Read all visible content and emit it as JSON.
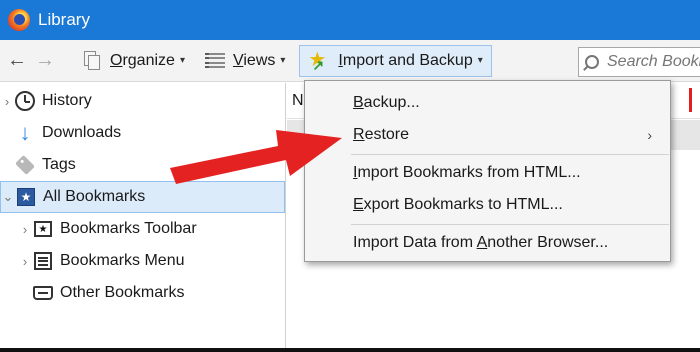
{
  "window": {
    "title": "Library"
  },
  "toolbar": {
    "organize_label": "Organize",
    "organize_hotkey": "O",
    "organize_rest": "rganize",
    "views_label": "Views",
    "views_hotkey": "V",
    "views_rest": "iews",
    "import_label": "Import and Backup",
    "import_hotkey": "I",
    "import_rest": "mport and Backup",
    "search_placeholder": "Search Bookmarks"
  },
  "sidebar": {
    "items": [
      {
        "label": "History",
        "icon": "clock-icon"
      },
      {
        "label": "Downloads",
        "icon": "download-arrow-icon"
      },
      {
        "label": "Tags",
        "icon": "tag-icon"
      },
      {
        "label": "All Bookmarks",
        "icon": "bookmarks-icon",
        "selected": true
      },
      {
        "label": "Bookmarks Toolbar",
        "icon": "toolbar-star-icon"
      },
      {
        "label": "Bookmarks Menu",
        "icon": "menu-list-icon"
      },
      {
        "label": "Other Bookmarks",
        "icon": "tray-icon"
      }
    ]
  },
  "content": {
    "column_header": "N"
  },
  "menu": {
    "items": [
      {
        "pre": "",
        "key": "B",
        "post": "ackup...",
        "label": "Backup..."
      },
      {
        "pre": "",
        "key": "R",
        "post": "estore",
        "label": "Restore",
        "submenu": true
      },
      {
        "pre": "",
        "key": "I",
        "post": "mport Bookmarks from HTML...",
        "label": "Import Bookmarks from HTML..."
      },
      {
        "pre": "",
        "key": "E",
        "post": "xport Bookmarks to HTML...",
        "label": "Export Bookmarks to HTML..."
      },
      {
        "pre": "Import Data from ",
        "key": "A",
        "post": "nother Browser...",
        "label": "Import Data from Another Browser..."
      }
    ],
    "submenu_arrow": "›"
  },
  "colors": {
    "titlebar": "#1a78d6",
    "selection": "#dcebfa",
    "annotation_arrow": "#e52222"
  }
}
